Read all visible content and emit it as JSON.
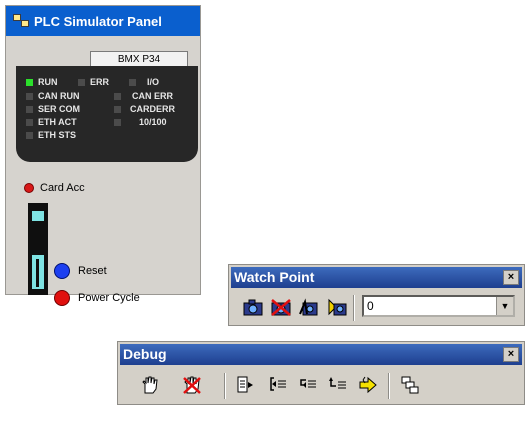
{
  "plc_panel": {
    "title": "PLC Simulator Panel",
    "model": "BMX P34",
    "leds": [
      {
        "label": "RUN",
        "on": true
      },
      {
        "label": "ERR",
        "on": false
      },
      {
        "label": "I/O",
        "on": false
      },
      {
        "label": "CAN RUN",
        "on": false
      },
      {
        "label": "CAN ERR",
        "on": false
      },
      {
        "label": "SER COM",
        "on": false
      },
      {
        "label": "CARDERR",
        "on": false
      },
      {
        "label": "ETH ACT",
        "on": false
      },
      {
        "label": "10/100",
        "on": false
      },
      {
        "label": "ETH STS",
        "on": false
      }
    ],
    "card_acc_label": "Card Acc",
    "reset_label": "Reset",
    "power_cycle_label": "Power Cycle"
  },
  "watch_point": {
    "title": "Watch Point",
    "close": "×",
    "combo_value": "0",
    "buttons": [
      "set-watch-icon",
      "clear-watch-icon",
      "show-watch-icon",
      "sync-watch-icon"
    ]
  },
  "debug": {
    "title": "Debug",
    "close": "×",
    "buttons": [
      "set-breakpoint-icon",
      "clear-breakpoint-icon",
      "go-icon",
      "step-into-icon",
      "step-over-icon",
      "step-out-icon",
      "show-current-step-icon",
      "call-stack-icon"
    ]
  },
  "colors": {
    "led_on": "#2be02b",
    "title_blue": "#0a5fce",
    "reset_blue": "#1c3ff0",
    "power_red": "#e0100e"
  }
}
